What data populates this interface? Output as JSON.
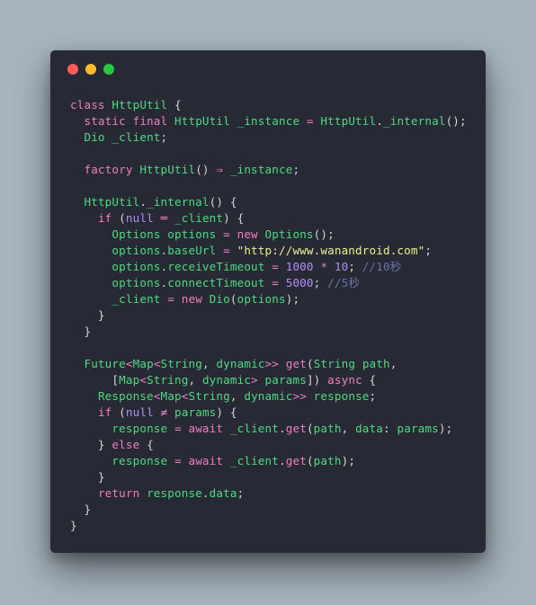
{
  "window": {
    "traffic_lights": [
      {
        "name": "close",
        "color": "#ff5f57"
      },
      {
        "name": "minimize",
        "color": "#febc2e"
      },
      {
        "name": "zoom",
        "color": "#28c840"
      }
    ]
  },
  "theme": {
    "keyword": "#f07ec0",
    "identifier": "#4fd980",
    "number": "#b48ef5",
    "string": "#e9ef91",
    "comment": "#6a73a8",
    "punctuation": "#d6d6d6",
    "background": "#272a35"
  },
  "code": {
    "language": "dart",
    "lines": [
      [
        [
          "kw",
          "class "
        ],
        [
          "ty",
          "HttpUtil "
        ],
        [
          "pu",
          "{"
        ]
      ],
      [
        [
          "pu",
          "  "
        ],
        [
          "kw",
          "static final "
        ],
        [
          "ty",
          "HttpUtil "
        ],
        [
          "id",
          "_instance "
        ],
        [
          "op",
          "= "
        ],
        [
          "ty",
          "HttpUtil"
        ],
        [
          "pu",
          "."
        ],
        [
          "id",
          "_internal"
        ],
        [
          "pu",
          "();"
        ]
      ],
      [
        [
          "pu",
          "  "
        ],
        [
          "ty",
          "Dio "
        ],
        [
          "id",
          "_client"
        ],
        [
          "pu",
          ";"
        ]
      ],
      [],
      [
        [
          "pu",
          "  "
        ],
        [
          "kw",
          "factory "
        ],
        [
          "ty",
          "HttpUtil"
        ],
        [
          "pu",
          "() "
        ],
        [
          "op",
          "⇒ "
        ],
        [
          "id",
          "_instance"
        ],
        [
          "pu",
          ";"
        ]
      ],
      [],
      [
        [
          "pu",
          "  "
        ],
        [
          "ty",
          "HttpUtil"
        ],
        [
          "pu",
          "."
        ],
        [
          "id",
          "_internal"
        ],
        [
          "pu",
          "() {"
        ]
      ],
      [
        [
          "pu",
          "    "
        ],
        [
          "kw",
          "if "
        ],
        [
          "pu",
          "("
        ],
        [
          "nu",
          "null "
        ],
        [
          "op",
          "═ "
        ],
        [
          "id",
          "_client"
        ],
        [
          "pu",
          ") {"
        ]
      ],
      [
        [
          "pu",
          "      "
        ],
        [
          "ty",
          "Options "
        ],
        [
          "id",
          "options "
        ],
        [
          "op",
          "= "
        ],
        [
          "kw",
          "new "
        ],
        [
          "ty",
          "Options"
        ],
        [
          "pu",
          "();"
        ]
      ],
      [
        [
          "pu",
          "      "
        ],
        [
          "id",
          "options"
        ],
        [
          "pu",
          "."
        ],
        [
          "id",
          "baseUrl "
        ],
        [
          "op",
          "= "
        ],
        [
          "st",
          "\"http://www.wanandroid.com\""
        ],
        [
          "pu",
          ";"
        ]
      ],
      [
        [
          "pu",
          "      "
        ],
        [
          "id",
          "options"
        ],
        [
          "pu",
          "."
        ],
        [
          "id",
          "receiveTimeout "
        ],
        [
          "op",
          "= "
        ],
        [
          "nu",
          "1000 "
        ],
        [
          "op",
          "* "
        ],
        [
          "nu",
          "10"
        ],
        [
          "pu",
          "; "
        ],
        [
          "cm",
          "//10秒"
        ]
      ],
      [
        [
          "pu",
          "      "
        ],
        [
          "id",
          "options"
        ],
        [
          "pu",
          "."
        ],
        [
          "id",
          "connectTimeout "
        ],
        [
          "op",
          "= "
        ],
        [
          "nu",
          "5000"
        ],
        [
          "pu",
          "; "
        ],
        [
          "cm",
          "//5秒"
        ]
      ],
      [
        [
          "pu",
          "      "
        ],
        [
          "id",
          "_client "
        ],
        [
          "op",
          "= "
        ],
        [
          "kw",
          "new "
        ],
        [
          "ty",
          "Dio"
        ],
        [
          "pu",
          "("
        ],
        [
          "id",
          "options"
        ],
        [
          "pu",
          ");"
        ]
      ],
      [
        [
          "pu",
          "    }"
        ]
      ],
      [
        [
          "pu",
          "  }"
        ]
      ],
      [],
      [
        [
          "pu",
          "  "
        ],
        [
          "ty",
          "Future"
        ],
        [
          "op",
          "<"
        ],
        [
          "ty",
          "Map"
        ],
        [
          "op",
          "<"
        ],
        [
          "ty",
          "String"
        ],
        [
          "pu",
          ", "
        ],
        [
          "ty",
          "dynamic"
        ],
        [
          "op",
          ">> "
        ],
        [
          "kw",
          "get"
        ],
        [
          "pu",
          "("
        ],
        [
          "ty",
          "String "
        ],
        [
          "id",
          "path"
        ],
        [
          "pu",
          ","
        ]
      ],
      [
        [
          "pu",
          "      ["
        ],
        [
          "ty",
          "Map"
        ],
        [
          "op",
          "<"
        ],
        [
          "ty",
          "String"
        ],
        [
          "pu",
          ", "
        ],
        [
          "ty",
          "dynamic"
        ],
        [
          "op",
          "> "
        ],
        [
          "id",
          "params"
        ],
        [
          "pu",
          "]) "
        ],
        [
          "kw",
          "async "
        ],
        [
          "pu",
          "{"
        ]
      ],
      [
        [
          "pu",
          "    "
        ],
        [
          "ty",
          "Response"
        ],
        [
          "op",
          "<"
        ],
        [
          "ty",
          "Map"
        ],
        [
          "op",
          "<"
        ],
        [
          "ty",
          "String"
        ],
        [
          "pu",
          ", "
        ],
        [
          "ty",
          "dynamic"
        ],
        [
          "op",
          ">> "
        ],
        [
          "id",
          "response"
        ],
        [
          "pu",
          ";"
        ]
      ],
      [
        [
          "pu",
          "    "
        ],
        [
          "kw",
          "if "
        ],
        [
          "pu",
          "("
        ],
        [
          "nu",
          "null "
        ],
        [
          "op",
          "≠ "
        ],
        [
          "id",
          "params"
        ],
        [
          "pu",
          ") {"
        ]
      ],
      [
        [
          "pu",
          "      "
        ],
        [
          "id",
          "response "
        ],
        [
          "op",
          "= "
        ],
        [
          "kw",
          "await "
        ],
        [
          "id",
          "_client"
        ],
        [
          "pu",
          "."
        ],
        [
          "kw",
          "get"
        ],
        [
          "pu",
          "("
        ],
        [
          "id",
          "path"
        ],
        [
          "pu",
          ", "
        ],
        [
          "id",
          "data"
        ],
        [
          "pu",
          ": "
        ],
        [
          "id",
          "params"
        ],
        [
          "pu",
          ");"
        ]
      ],
      [
        [
          "pu",
          "    } "
        ],
        [
          "kw",
          "else "
        ],
        [
          "pu",
          "{"
        ]
      ],
      [
        [
          "pu",
          "      "
        ],
        [
          "id",
          "response "
        ],
        [
          "op",
          "= "
        ],
        [
          "kw",
          "await "
        ],
        [
          "id",
          "_client"
        ],
        [
          "pu",
          "."
        ],
        [
          "kw",
          "get"
        ],
        [
          "pu",
          "("
        ],
        [
          "id",
          "path"
        ],
        [
          "pu",
          ");"
        ]
      ],
      [
        [
          "pu",
          "    }"
        ]
      ],
      [
        [
          "pu",
          "    "
        ],
        [
          "kw",
          "return "
        ],
        [
          "id",
          "response"
        ],
        [
          "pu",
          "."
        ],
        [
          "id",
          "data"
        ],
        [
          "pu",
          ";"
        ]
      ],
      [
        [
          "pu",
          "  }"
        ]
      ],
      [
        [
          "pu",
          "}"
        ]
      ]
    ]
  }
}
